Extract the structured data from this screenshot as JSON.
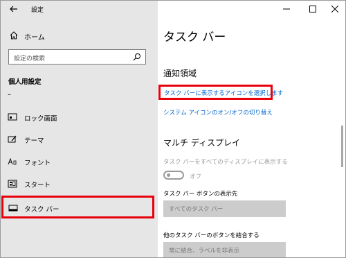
{
  "window": {
    "title": "設定",
    "controls": {
      "minimize": "—",
      "maximize": "☐",
      "close": "✕"
    }
  },
  "sidebar": {
    "home_label": "ホーム",
    "search_placeholder": "設定の検索",
    "section_title": "個人用設定",
    "items": [
      {
        "label": "–",
        "icon": "dash-icon"
      },
      {
        "label": "ロック画面",
        "icon": "lock-screen-icon"
      },
      {
        "label": "テーマ",
        "icon": "theme-icon"
      },
      {
        "label": "フォント",
        "icon": "font-icon"
      },
      {
        "label": "スタート",
        "icon": "start-icon"
      },
      {
        "label": "タスク バー",
        "icon": "taskbar-icon",
        "selected": true
      }
    ]
  },
  "main": {
    "title": "タスク バー",
    "notification_area": {
      "heading": "通知領域",
      "link_select_icons": "タスク バーに表示するアイコンを選択します",
      "link_system_icons": "システム アイコンのオン/オフの切り替え"
    },
    "multi_display": {
      "heading": "マルチ ディスプレイ",
      "show_all_label": "タスク バーをすべてのディスプレイに表示する",
      "toggle_state": "オフ",
      "buttons_location_label": "タスク バー ボタンの表示先",
      "buttons_location_value": "すべてのタスク バー",
      "combine_label": "他のタスク バーのボタンを結合する",
      "combine_value": "常に結合、ラベルを非表示"
    }
  },
  "colors": {
    "highlight_red": "#e8000b",
    "link_blue": "#0066cc",
    "sidebar_bg": "#e6e6e6",
    "disabled_gray": "#9a9a9a"
  }
}
